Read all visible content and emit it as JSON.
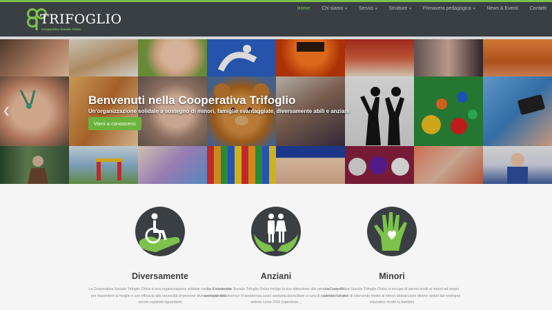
{
  "brand": {
    "name": "TRIFOGLIO",
    "tagline": "Cooperativa Sociale Onlus",
    "accent": "#7cc24b",
    "header_bg": "#3a3f44"
  },
  "nav": {
    "items": [
      {
        "label": "Home",
        "active": true,
        "dropdown": false
      },
      {
        "label": "Chi siamo",
        "active": false,
        "dropdown": true
      },
      {
        "label": "Servizi",
        "active": false,
        "dropdown": true
      },
      {
        "label": "Strutture",
        "active": false,
        "dropdown": true
      },
      {
        "label": "Primavera pedagogica",
        "active": false,
        "dropdown": true
      },
      {
        "label": "News & Eventi",
        "active": false,
        "dropdown": false
      },
      {
        "label": "Contatti",
        "active": false,
        "dropdown": false
      }
    ],
    "caret": "▾"
  },
  "hero": {
    "title": "Benvenuti nella Cooperativa Trifoglio",
    "subtitle": "Un'organizzazione solidale a sostegno di minori, famiglie svantaggiate, diversamente abili e anziani",
    "button_label": "Vieni a conoscerci",
    "prev_icon": "chevron-left-icon",
    "prev_glyph": "❮"
  },
  "features": [
    {
      "icon": "wheelchair-hand-icon",
      "title": "Diversamente",
      "text": "La Cooperativa Sociale Trifoglio Onlus è una organizzazione solidale creata e strutturata per rispondere al meglio e con efficacia alle necessità di persone diversamente abili. I servizi espletati riguardano"
    },
    {
      "icon": "elderly-couple-hands-icon",
      "title": "Anziani",
      "text": "La Cooperativa Sociale Trifoglio Onlus rivolge la sua attenzione alle persone over 65, predisponendo servizi di assistenza socio sanitaria domiciliare a cura di professionisti del settore come OSS (operatore..."
    },
    {
      "icon": "heart-hand-icon",
      "title": "Minori",
      "text": "La Cooperativa Sociale Trifoglio Onlus si occupa di servizi rivolti ai minori ad ampio spettro. Le aree di intervento rivolte ai minori abbracciano diversi ambiti dal sostegno educativo rivolto ai bambini"
    }
  ]
}
